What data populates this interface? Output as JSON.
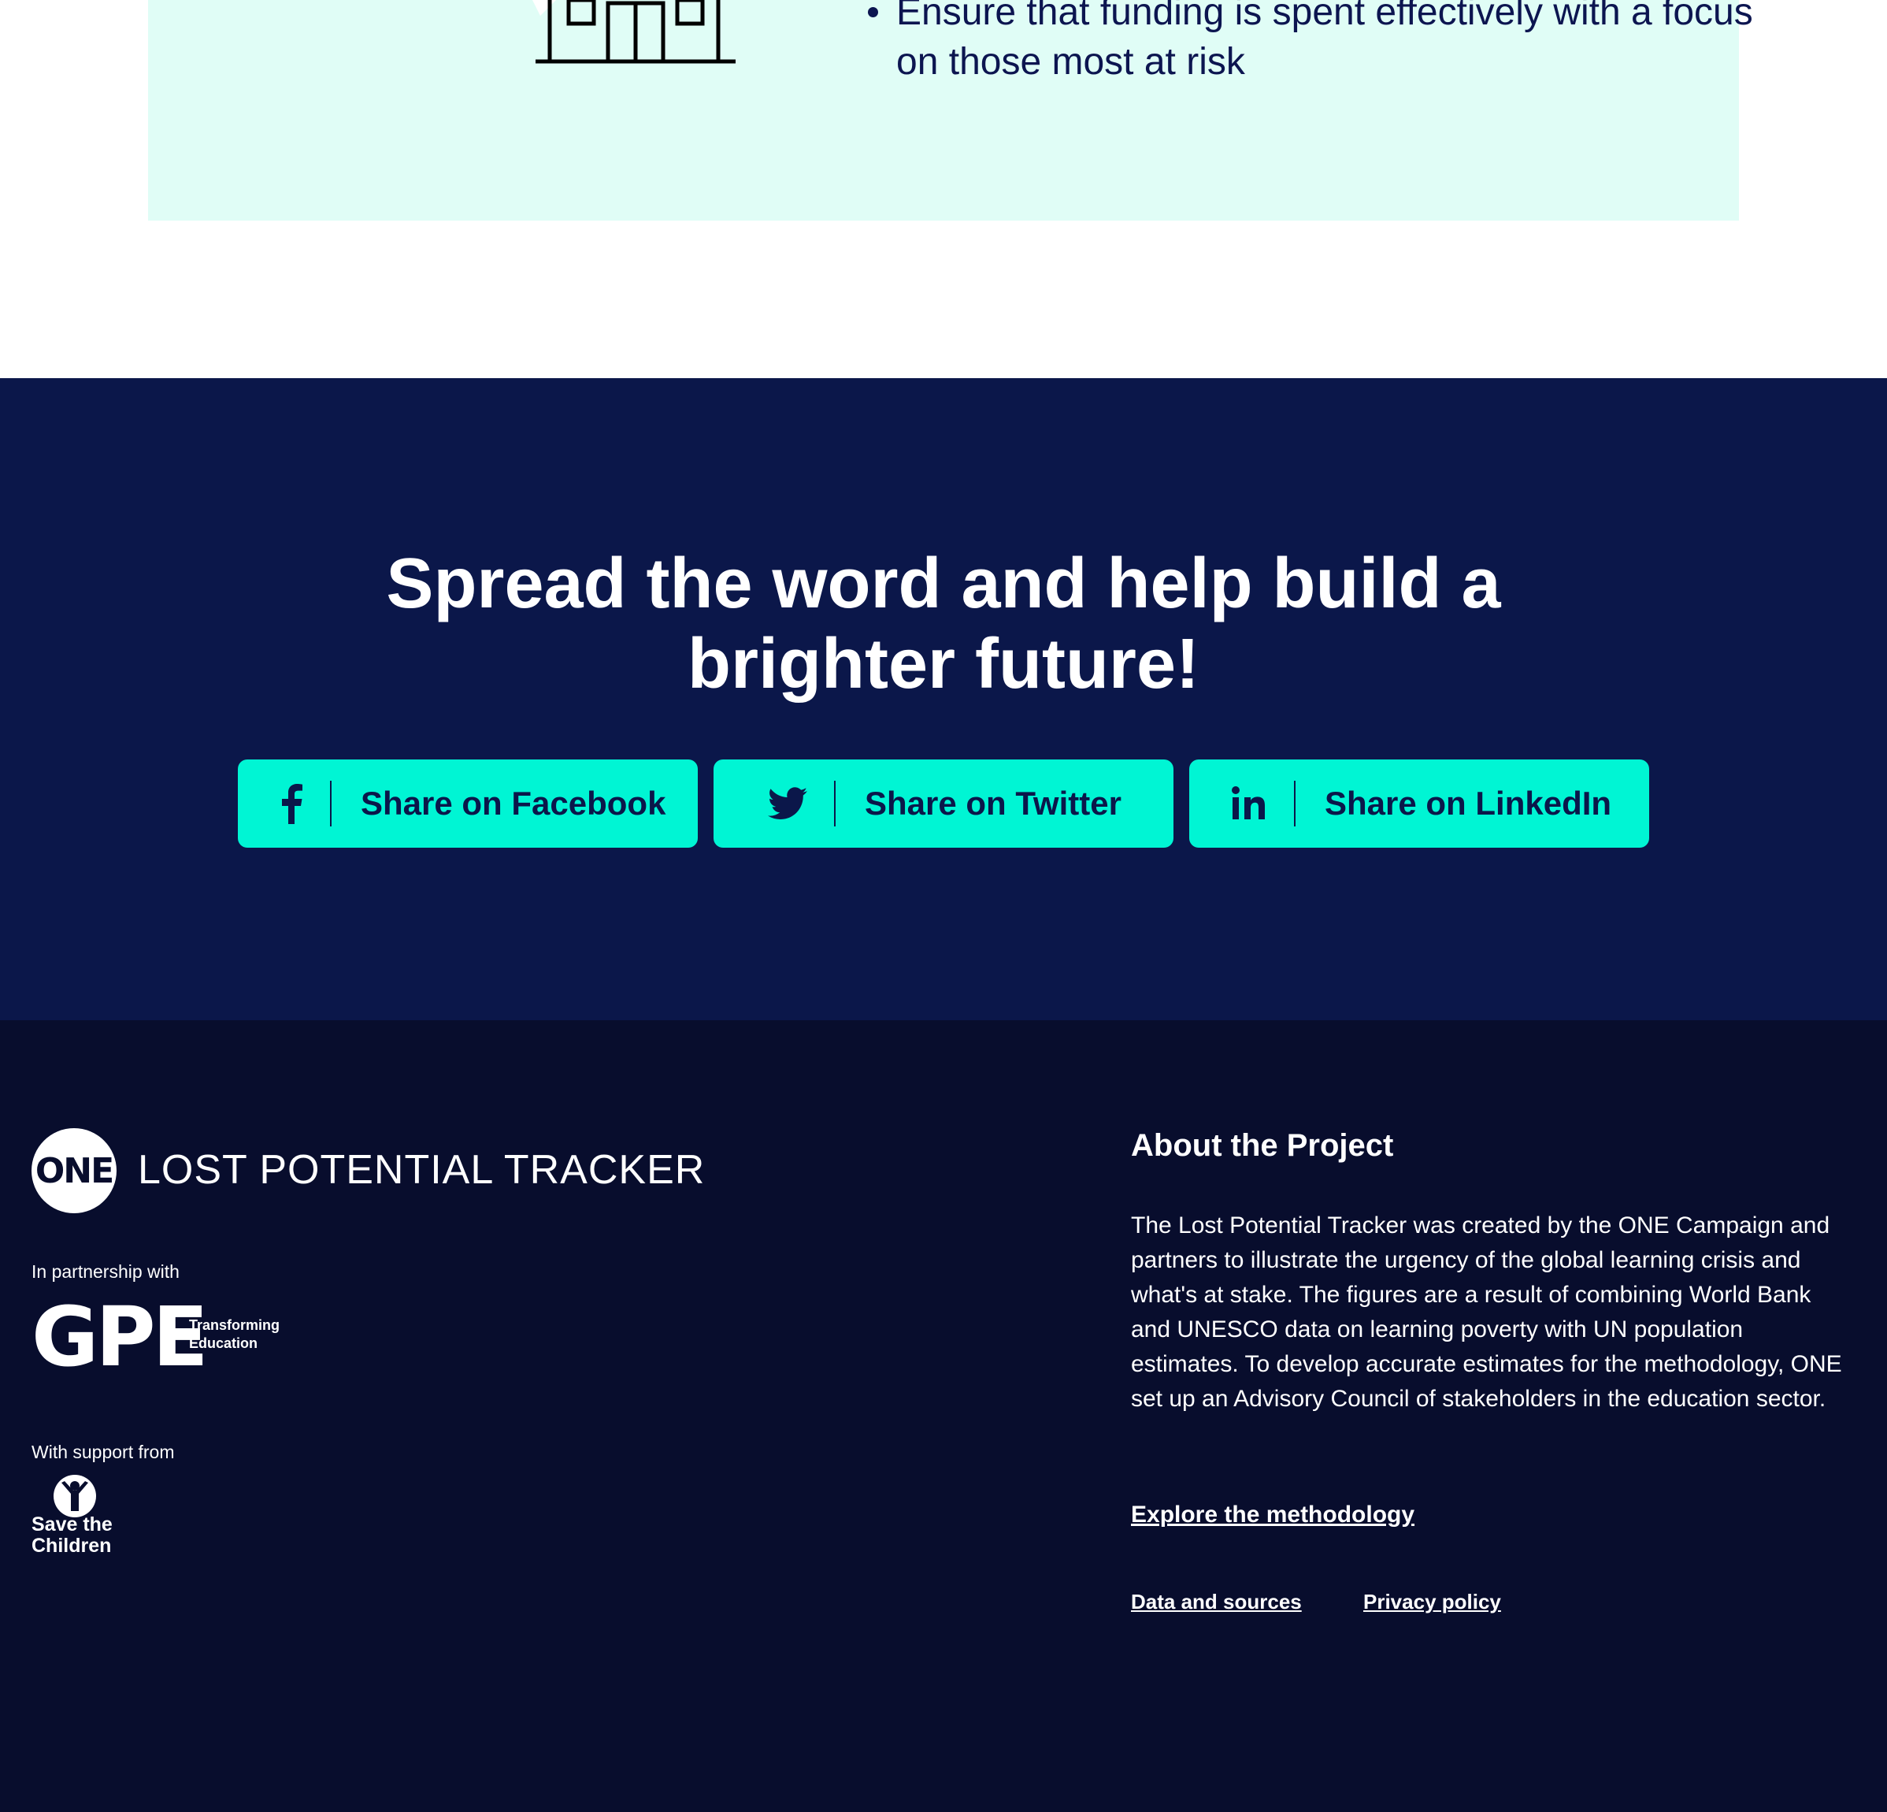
{
  "colors": {
    "card_bg": "#e0fdf6",
    "navy": "#0b174a",
    "footer_bg": "#080d2d",
    "accent": "#00f5d4",
    "text_dark": "#0c1550",
    "white": "#ffffff"
  },
  "top_card": {
    "icon": "school-building-icon",
    "bullets": [
      "Ensure that funding is spent effectively with a focus on those most at risk"
    ]
  },
  "share": {
    "title_line1": "Spread the word and help build a",
    "title_line2": "brighter future!",
    "buttons": [
      {
        "label": "Share on Facebook",
        "icon": "facebook-icon"
      },
      {
        "label": "Share on Twitter",
        "icon": "twitter-icon"
      },
      {
        "label": "Share on LinkedIn",
        "icon": "linkedin-icon"
      }
    ]
  },
  "footer": {
    "one_logo_text": "ONE",
    "site_title": "LOST POTENTIAL TRACKER",
    "partner_label": "In partnership with",
    "gpe": {
      "letters": "GPE",
      "tagline_line1": "Transforming",
      "tagline_line2": "Education"
    },
    "support_label": "With support from",
    "stc": {
      "line1": "Save the",
      "line2": "Children"
    },
    "about_title": "About the Project",
    "about_text": "The Lost Potential Tracker was created by the ONE Campaign and partners to illustrate the urgency of the global learning crisis and what's at stake. The figures are a result of combining World Bank and UNESCO data on learning poverty with UN population estimates. To develop accurate estimates for the methodology, ONE set up an Advisory Council of stakeholders in the education sector.",
    "links": {
      "methodology": "Explore the methodology",
      "data_sources": "Data and sources",
      "privacy": "Privacy policy"
    }
  }
}
